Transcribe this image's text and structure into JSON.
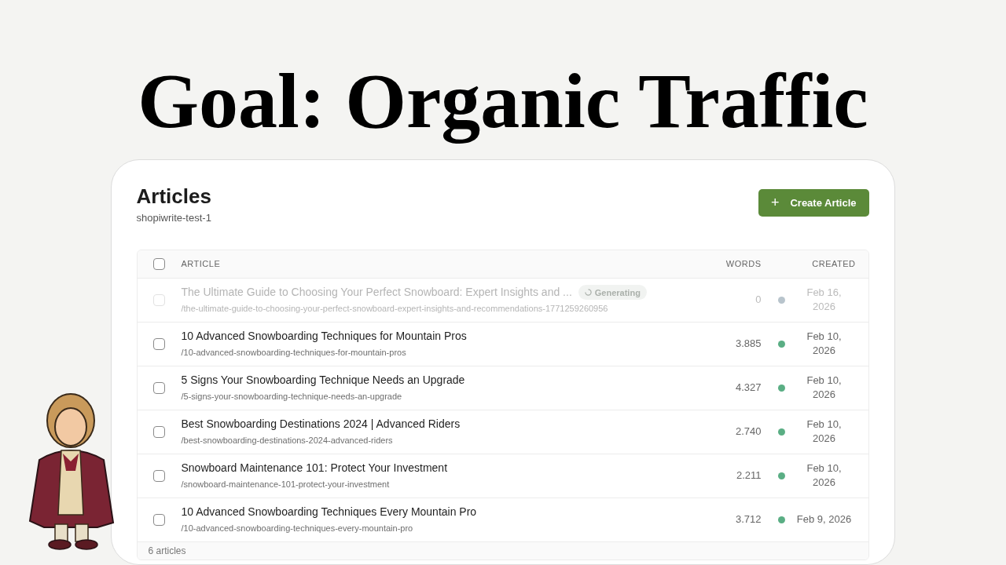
{
  "headline": "Goal: Organic Traffic",
  "page": {
    "title": "Articles",
    "subtitle": "shopiwrite-test-1",
    "create_button": {
      "icon": "+",
      "label": "Create Article"
    }
  },
  "table": {
    "columns": [
      "ARTICLE",
      "WORDS",
      "CREATED"
    ],
    "select_all": {
      "checked": false
    },
    "rows": [
      {
        "title": "The Ultimate Guide to Choosing Your Perfect Snowboard: Expert Insights and ...",
        "slug": "/the-ultimate-guide-to-choosing-your-perfect-snowboard-expert-insights-and-recommendations-1771259260956",
        "badge": "Generating",
        "dimmed": true,
        "checked": false,
        "words": "0",
        "color": "#b8c4cc",
        "created": [
          "Feb 16,",
          "2026"
        ]
      },
      {
        "title": "10 Advanced Snowboarding Techniques for Mountain Pros",
        "slug": "/10-advanced-snowboarding-techniques-for-mountain-pros",
        "dimmed": false,
        "checked": false,
        "words": "3.885",
        "color": "#5aae84",
        "created": [
          "Feb 10,",
          "2026"
        ]
      },
      {
        "title": "5 Signs Your Snowboarding Technique Needs an Upgrade",
        "slug": "/5-signs-your-snowboarding-technique-needs-an-upgrade",
        "dimmed": false,
        "checked": false,
        "words": "4.327",
        "color": "#5aae84",
        "created": [
          "Feb 10,",
          "2026"
        ]
      },
      {
        "title": "Best Snowboarding Destinations 2024 | Advanced Riders",
        "slug": "/best-snowboarding-destinations-2024-advanced-riders",
        "dimmed": false,
        "checked": false,
        "words": "2.740",
        "color": "#5aae84",
        "created": [
          "Feb 10,",
          "2026"
        ]
      },
      {
        "title": "Snowboard Maintenance 101: Protect Your Investment",
        "slug": "/snowboard-maintenance-101-protect-your-investment",
        "dimmed": false,
        "checked": false,
        "words": "2.211",
        "color": "#5aae84",
        "created": [
          "Feb 10,",
          "2026"
        ]
      },
      {
        "title": "10 Advanced Snowboarding Techniques Every Mountain Pro",
        "slug": "/10-advanced-snowboarding-techniques-every-mountain-pro",
        "dimmed": false,
        "checked": false,
        "words": "3.712",
        "color": "#5aae84",
        "created": [
          "Feb 9, 2026"
        ]
      }
    ],
    "footer": "6 articles"
  }
}
